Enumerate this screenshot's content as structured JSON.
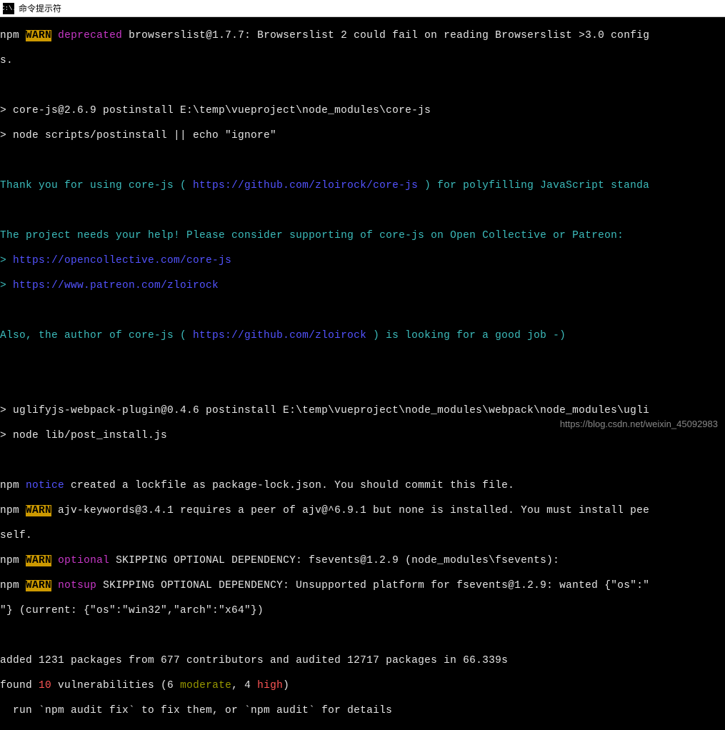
{
  "titlebar": {
    "icon_text": "C:\\.",
    "title": "命令提示符"
  },
  "term": {
    "npm": "npm",
    "warn": "WARN",
    "deprecated": "deprecated",
    "notice": "notice",
    "optional": "optional",
    "notsup": "notsup",
    "l1_rest": " browserslist@1.7.7: Browserslist 2 could fail on reading Browserslist >3.0 config",
    "l2": "s.",
    "l4": "> core-js@2.6.9 postinstall E:\\temp\\vueproject\\node_modules\\core-js",
    "l5": "> node scripts/postinstall || echo \"ignore\"",
    "thank_pre": "Thank you for using core-js ( ",
    "thank_url": "https://github.com/zloirock/core-js",
    "thank_post": " ) for polyfilling JavaScript standa",
    "help": "The project needs your help! Please consider supporting of core-js on Open Collective or Patreon:",
    "gt": ">",
    "url_oc": " https://opencollective.com/core-js",
    "url_pt": " https://www.patreon.com/zloirock",
    "also_pre": "Also, the author of core-js ( ",
    "also_url": "https://github.com/zloirock",
    "also_post": " ) is looking for a good job -)",
    "l_ugl": "> uglifyjs-webpack-plugin@0.4.6 postinstall E:\\temp\\vueproject\\node_modules\\webpack\\node_modules\\ugli",
    "l_ugl2": "> node lib/post_install.js",
    "notice_rest": " created a lockfile as package-lock.json. You should commit this file.",
    "ajv_rest": " ajv-keywords@3.4.1 requires a peer of ajv@^6.9.1 but none is installed. You must install pee",
    "self": "self.",
    "opt_rest": " SKIPPING OPTIONAL DEPENDENCY: fsevents@1.2.9 (node_modules\\fsevents):",
    "ns_rest": " SKIPPING OPTIONAL DEPENDENCY: Unsupported platform for fsevents@1.2.9: wanted {\"os\":\"",
    "ns_rest2": "\"} (current: {\"os\":\"win32\",\"arch\":\"x64\"})",
    "added": "added 1231 packages from 677 contributors and audited 12717 packages in 66.339s",
    "found_pre": "found ",
    "found_n": "10",
    "found_mid": " vulnerabilities (6 ",
    "moderate": "moderate",
    "found_mid2": ", 4 ",
    "high": "high",
    "found_end": ")",
    "audit": "  run `npm audit fix` to fix them, or `npm audit` for details"
  },
  "watermark": "https://blog.csdn.net/weixin_45092983"
}
